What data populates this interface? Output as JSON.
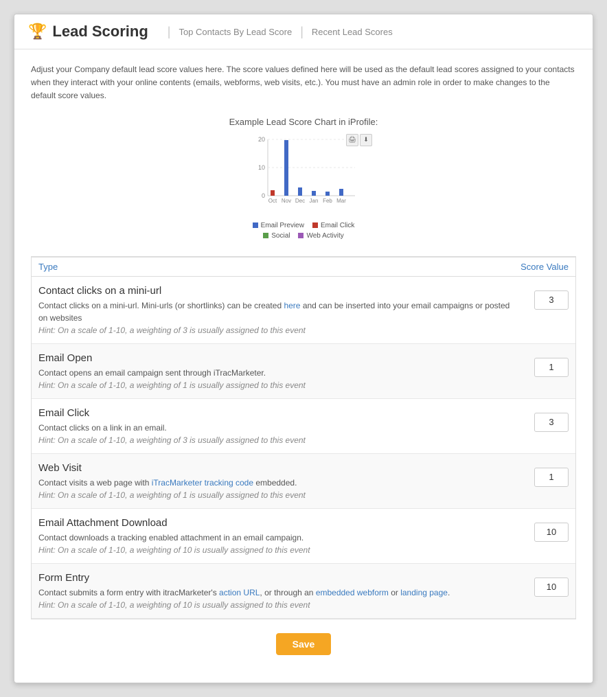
{
  "header": {
    "title": "Lead Scoring",
    "nav": [
      {
        "label": "Top Contacts By Lead Score",
        "id": "top-contacts"
      },
      {
        "label": "Recent Lead Scores",
        "id": "recent-scores"
      }
    ]
  },
  "description": "Adjust your Company default lead score values here. The score values defined here will be used as the default lead scores assigned to your contacts when they interact with your online contents (emails, webforms, web visits, etc.). You must have an admin role in order to make changes to the default score values.",
  "chart": {
    "title": "Example Lead Score Chart in iProfile:",
    "y_labels": [
      "20",
      "10",
      "0"
    ],
    "x_labels": [
      "Oct",
      "Nov",
      "Dec",
      "Jan",
      "Feb",
      "Mar"
    ],
    "legend": [
      {
        "color": "#4169c5",
        "label": "Email Preview"
      },
      {
        "color": "#c0392b",
        "label": "Email Click"
      },
      {
        "color": "#5a9e4a",
        "label": "Social"
      },
      {
        "color": "#9b59b6",
        "label": "Web Activity"
      }
    ]
  },
  "table": {
    "col_type": "Type",
    "col_score": "Score Value",
    "rows": [
      {
        "title": "Contact clicks on a mini-url",
        "desc_parts": [
          {
            "text": "Contact clicks on a mini-url. Mini-urls (or shortlinks) can be created "
          },
          {
            "text": "here",
            "link": true
          },
          {
            "text": " and can be inserted into your email campaigns or posted on websites"
          }
        ],
        "hint": "Hint: On a scale of 1-10, a weighting of 3 is usually assigned to this event",
        "score": "3"
      },
      {
        "title": "Email Open",
        "desc_parts": [
          {
            "text": "Contact opens an email campaign sent through iTracMarketer."
          }
        ],
        "hint": "Hint: On a scale of 1-10, a weighting of 1 is usually assigned to this event",
        "score": "1"
      },
      {
        "title": "Email Click",
        "desc_parts": [
          {
            "text": "Contact clicks on a link in an email."
          }
        ],
        "hint": "Hint: On a scale of 1-10, a weighting of 3 is usually assigned to this event",
        "score": "3"
      },
      {
        "title": "Web Visit",
        "desc_parts": [
          {
            "text": "Contact visits a web page with "
          },
          {
            "text": "iTracMarketer tracking code",
            "link": true
          },
          {
            "text": " embedded."
          }
        ],
        "hint": "Hint: On a scale of 1-10, a weighting of 1 is usually assigned to this event",
        "score": "1"
      },
      {
        "title": "Email Attachment Download",
        "desc_parts": [
          {
            "text": "Contact downloads a tracking enabled attachment in an email campaign."
          }
        ],
        "hint": "Hint: On a scale of 1-10, a weighting of 10 is usually assigned to this event",
        "score": "10"
      },
      {
        "title": "Form Entry",
        "desc_parts": [
          {
            "text": "Contact submits a form entry with itracMarketer's "
          },
          {
            "text": "action URL",
            "link": true
          },
          {
            "text": ", or through an "
          },
          {
            "text": "embedded webform",
            "link": true
          },
          {
            "text": " or "
          },
          {
            "text": "landing page",
            "link": true
          },
          {
            "text": "."
          }
        ],
        "hint": "Hint: On a scale of 1-10, a weighting of 10 is usually assigned to this event",
        "score": "10"
      }
    ]
  },
  "save_label": "Save"
}
